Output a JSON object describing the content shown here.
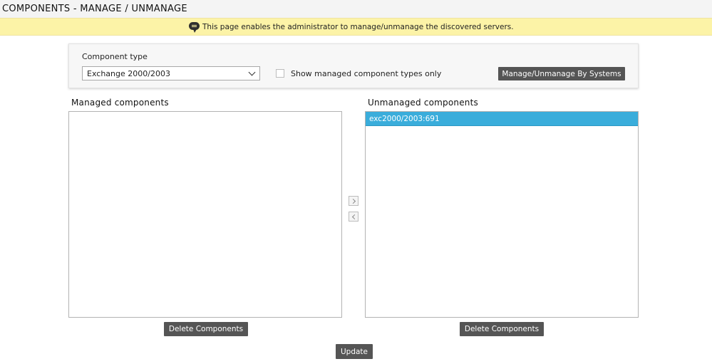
{
  "page": {
    "title": "COMPONENTS - MANAGE / UNMANAGE"
  },
  "info": {
    "icon": "speech-bubble-icon",
    "message": "This page enables the administrator to manage/unmanage the discovered servers."
  },
  "filter": {
    "label": "Component type",
    "selected_value": "Exchange 2000/2003",
    "checkbox_label": "Show managed component types only",
    "checkbox_checked": false,
    "manage_by_systems_label": "Manage/Unmanage By Systems"
  },
  "managed": {
    "heading": "Managed components",
    "items": [],
    "delete_label": "Delete Components"
  },
  "unmanaged": {
    "heading": "Unmanaged components",
    "items": [
      {
        "label": "exc2000/2003:691",
        "selected": true
      }
    ],
    "delete_label": "Delete Components"
  },
  "actions": {
    "move_right_icon": "chevron-right-icon",
    "move_left_icon": "chevron-left-icon",
    "update_label": "Update"
  },
  "colors": {
    "info_bar": "#fcf3a7",
    "button": "#555555",
    "selection": "#3aaddb"
  }
}
